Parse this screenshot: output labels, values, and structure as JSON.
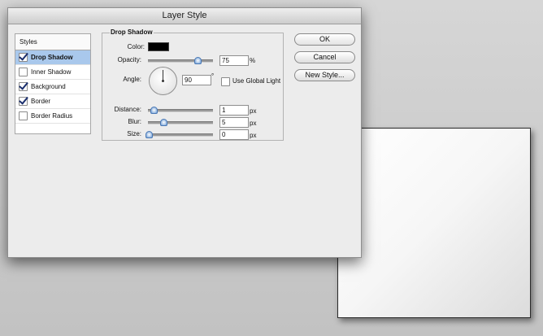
{
  "dialog": {
    "title": "Layer Style"
  },
  "styles_panel": {
    "header": "Styles",
    "items": [
      {
        "label": "Drop Shadow",
        "checked": true,
        "selected": true
      },
      {
        "label": "Inner Shadow",
        "checked": false,
        "selected": false
      },
      {
        "label": "Background",
        "checked": true,
        "selected": false
      },
      {
        "label": "Border",
        "checked": true,
        "selected": false
      },
      {
        "label": "Border Radius",
        "checked": false,
        "selected": false
      }
    ]
  },
  "drop_shadow": {
    "group_title": "Drop Shadow",
    "color_label": "Color:",
    "color_value": "#000000",
    "opacity_label": "Opacity:",
    "opacity_value": "75",
    "opacity_unit": "%",
    "angle_label": "Angle:",
    "angle_value": "90",
    "angle_unit": "°",
    "use_global_light_label": "Use Global Light",
    "use_global_light_checked": false,
    "distance_label": "Distance:",
    "distance_value": "1",
    "distance_unit": "px",
    "blur_label": "Blur:",
    "blur_value": "5",
    "blur_unit": "px",
    "size_label": "Size:",
    "size_value": "0",
    "size_unit": "px"
  },
  "buttons": {
    "ok": "OK",
    "cancel": "Cancel",
    "new_style": "New Style..."
  },
  "icons": {
    "checkbox": "checkbox-icon",
    "angle_dial": "angle-dial-icon",
    "slider_thumb": "slider-thumb-icon"
  }
}
